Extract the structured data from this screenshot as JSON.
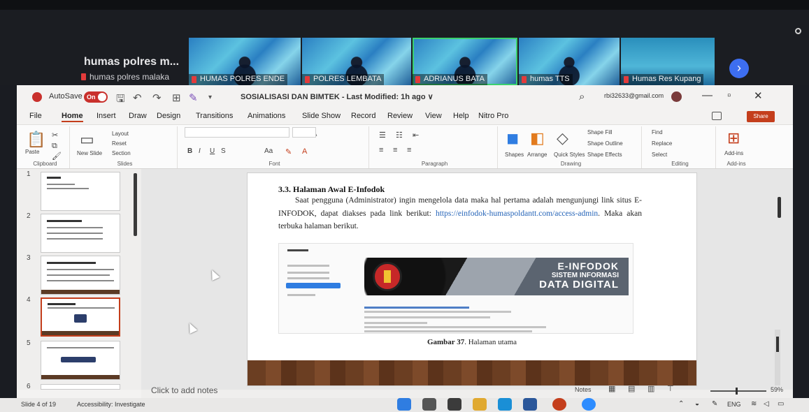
{
  "zoom": {
    "self_name": "humas polres m...",
    "self_tag": "humas polres malaka",
    "tiles": [
      {
        "label": "HUMAS POLRES ENDE"
      },
      {
        "label": "POLRES LEMBATA"
      },
      {
        "label": "ADRIANUS BATA"
      },
      {
        "label": "humas TTS"
      },
      {
        "label": "Humas Res Kupang"
      }
    ],
    "next_label": "›"
  },
  "ppt": {
    "autosave_label": "AutoSave",
    "autosave_state": "On",
    "doc_title": "SOSIALISASI DAN BIMTEK - Last Modified: 1h ago ∨",
    "user_email": "rbi32633@gmail.com",
    "tabs": [
      "File",
      "Home",
      "Insert",
      "Draw",
      "Design",
      "Transitions",
      "Animations",
      "Slide Show",
      "Record",
      "Review",
      "View",
      "Help",
      "Nitro Pro"
    ],
    "share_label": "Share",
    "ribbon": {
      "clipboard": {
        "paste": "Paste",
        "label": "Clipboard"
      },
      "slides": {
        "new_slide": "New Slide",
        "layout": "Layout",
        "reset": "Reset",
        "section": "Section",
        "label": "Slides"
      },
      "font": {
        "label": "Font",
        "bold": "B",
        "italic": "I",
        "underline": "U",
        "strike": "S",
        "size_up": "A",
        "size_down": "A",
        "case": "Aa"
      },
      "paragraph": {
        "label": "Paragraph"
      },
      "drawing": {
        "shapes": "Shapes",
        "arrange": "Arrange",
        "quick_styles": "Quick Styles",
        "shape_fill": "Shape Fill",
        "shape_outline": "Shape Outline",
        "shape_effects": "Shape Effects",
        "label": "Drawing"
      },
      "editing": {
        "find": "Find",
        "replace": "Replace",
        "select": "Select",
        "label": "Editing"
      },
      "addins": {
        "label": "Add-ins",
        "button": "Add-ins"
      }
    },
    "thumbnails": [
      "1",
      "2",
      "3",
      "4",
      "5",
      "6"
    ],
    "slide": {
      "heading": "3.3. Halaman Awal E-Infodok",
      "para_1": "Saat pengguna (Administrator) ingin mengelola data maka hal pertama adalah mengunjungi link situs E-INFODOK, dapat diakses pada link berikut:",
      "link": "https://einfodok-humaspoldantt.com/access-admin",
      "para_2": ". Maka akan terbuka halaman berikut.",
      "banner_1": "E-INFODOK",
      "banner_2": "SISTEM INFORMASI",
      "banner_3": "DATA DIGITAL",
      "caption_bold": "Gambar 37",
      "caption_rest": ". Halaman utama"
    },
    "notes_placeholder": "Click to add notes",
    "notes_btn": "Notes",
    "zoom_pct": "59%"
  },
  "statusbar": {
    "slide_info": "Slide 4 of 19",
    "accessibility": "Accessibility: Investigate",
    "lang": "ENG"
  }
}
